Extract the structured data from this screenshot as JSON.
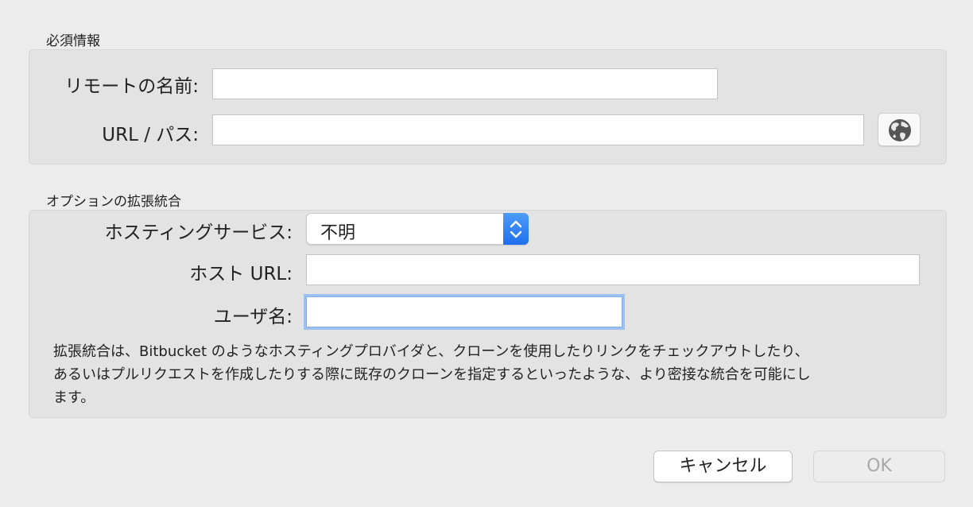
{
  "required": {
    "title": "必須情報",
    "remote_name_label": "リモートの名前:",
    "remote_name_value": "",
    "url_label": "URL / パス:",
    "url_value": "",
    "globe_icon": "globe-icon"
  },
  "optional": {
    "title": "オプションの拡張統合",
    "hosting_label": "ホスティングサービス:",
    "hosting_value": "不明",
    "host_url_label": "ホスト URL:",
    "host_url_value": "",
    "username_label": "ユーザ名:",
    "username_value": "",
    "description_lines": [
      "拡張統合は、Bitbucket のようなホスティングプロバイダと、クローンを使用したりリンクをチェックアウトしたり、",
      "あるいはプルリクエストを作成したりする際に既存のクローンを指定するといったような、より密接な統合を可能にし",
      "ます。"
    ]
  },
  "buttons": {
    "cancel": "キャンセル",
    "ok": "OK"
  },
  "colors": {
    "accent": "#1f6ff0",
    "focus_ring": "#9cc0ef"
  }
}
